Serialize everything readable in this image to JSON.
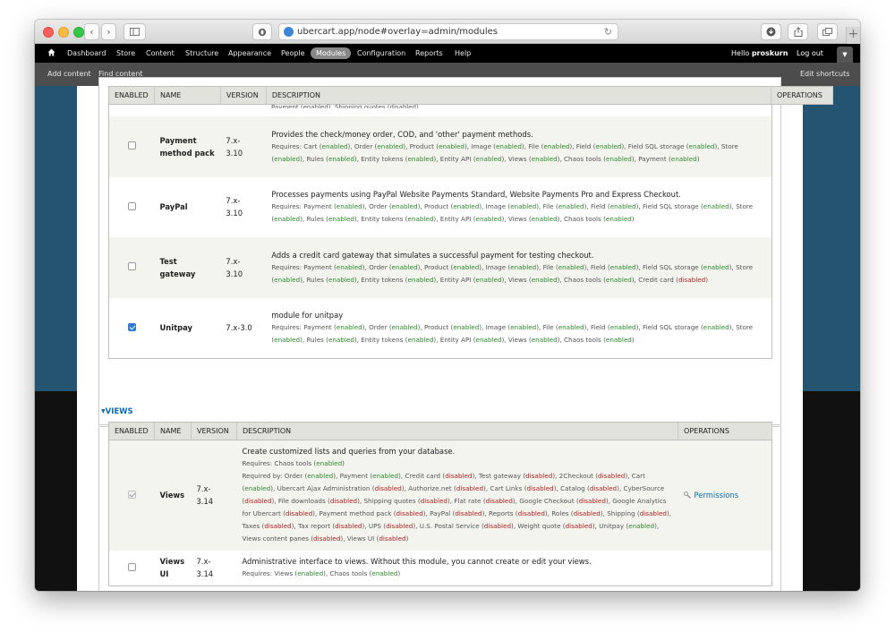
{
  "browser": {
    "url": "ubercart.app/node#overlay=admin/modules",
    "plus_label": "+"
  },
  "toolbar": {
    "menu": [
      {
        "label": "Dashboard"
      },
      {
        "label": "Store"
      },
      {
        "label": "Content"
      },
      {
        "label": "Structure"
      },
      {
        "label": "Appearance"
      },
      {
        "label": "People"
      },
      {
        "label": "Modules"
      },
      {
        "label": "Configuration"
      },
      {
        "label": "Reports"
      },
      {
        "label": "Help"
      }
    ],
    "hello_prefix": "Hello",
    "username": "proskurn",
    "logout": "Log out"
  },
  "shortcuts": {
    "add_content": "Add content",
    "find_content": "Find content",
    "edit_shortcuts": "Edit shortcuts"
  },
  "table1": {
    "headers": {
      "enabled": "ENABLED",
      "name": "NAME",
      "version": "VERSION",
      "description": "DESCRIPTION",
      "operations": "OPERATIONS"
    },
    "cutoff_text": "Payment (enabled), Shipping quotes (disabled)",
    "rows": [
      {
        "name1": "Payment",
        "name2": "method pack",
        "ver1": "7.x-",
        "ver2": "3.10",
        "checked": false,
        "desc": "Provides the check/money order, COD, and 'other' payment methods.",
        "req_label": "Requires:",
        "deps": [
          [
            "Cart",
            "enabled"
          ],
          [
            "Order",
            "enabled"
          ],
          [
            "Product",
            "enabled"
          ],
          [
            "Image",
            "enabled"
          ],
          [
            "File",
            "enabled"
          ],
          [
            "Field",
            "enabled"
          ],
          [
            "Field SQL storage",
            "enabled"
          ],
          [
            "Store",
            "enabled"
          ],
          [
            "Rules",
            "enabled"
          ],
          [
            "Entity tokens",
            "enabled"
          ],
          [
            "Entity API",
            "enabled"
          ],
          [
            "Views",
            "enabled"
          ],
          [
            "Chaos tools",
            "enabled"
          ],
          [
            "Payment",
            "enabled"
          ]
        ]
      },
      {
        "name1": "PayPal",
        "name2": "",
        "ver1": "7.x-",
        "ver2": "3.10",
        "checked": false,
        "desc": "Processes payments using PayPal Website Payments Standard, Website Payments Pro and Express Checkout.",
        "req_label": "Requires:",
        "deps": [
          [
            "Payment",
            "enabled"
          ],
          [
            "Order",
            "enabled"
          ],
          [
            "Product",
            "enabled"
          ],
          [
            "Image",
            "enabled"
          ],
          [
            "File",
            "enabled"
          ],
          [
            "Field",
            "enabled"
          ],
          [
            "Field SQL storage",
            "enabled"
          ],
          [
            "Store",
            "enabled"
          ],
          [
            "Rules",
            "enabled"
          ],
          [
            "Entity tokens",
            "enabled"
          ],
          [
            "Entity API",
            "enabled"
          ],
          [
            "Views",
            "enabled"
          ],
          [
            "Chaos tools",
            "enabled"
          ]
        ]
      },
      {
        "name1": "Test gateway",
        "name2": "",
        "ver1": "7.x-",
        "ver2": "3.10",
        "checked": false,
        "desc": "Adds a credit card gateway that simulates a successful payment for testing checkout.",
        "req_label": "Requires:",
        "deps": [
          [
            "Payment",
            "enabled"
          ],
          [
            "Order",
            "enabled"
          ],
          [
            "Product",
            "enabled"
          ],
          [
            "Image",
            "enabled"
          ],
          [
            "File",
            "enabled"
          ],
          [
            "Field",
            "enabled"
          ],
          [
            "Field SQL storage",
            "enabled"
          ],
          [
            "Store",
            "enabled"
          ],
          [
            "Rules",
            "enabled"
          ],
          [
            "Entity tokens",
            "enabled"
          ],
          [
            "Entity API",
            "enabled"
          ],
          [
            "Views",
            "enabled"
          ],
          [
            "Chaos tools",
            "enabled"
          ],
          [
            "Credit card",
            "disabled"
          ]
        ]
      },
      {
        "name1": "Unitpay",
        "name2": "",
        "ver1": "7.x-3.0",
        "ver2": "",
        "checked": true,
        "desc": "module for unitpay",
        "req_label": "Requires:",
        "deps": [
          [
            "Payment",
            "enabled"
          ],
          [
            "Order",
            "enabled"
          ],
          [
            "Product",
            "enabled"
          ],
          [
            "Image",
            "enabled"
          ],
          [
            "File",
            "enabled"
          ],
          [
            "Field",
            "enabled"
          ],
          [
            "Field SQL storage",
            "enabled"
          ],
          [
            "Store",
            "enabled"
          ],
          [
            "Rules",
            "enabled"
          ],
          [
            "Entity tokens",
            "enabled"
          ],
          [
            "Entity API",
            "enabled"
          ],
          [
            "Views",
            "enabled"
          ],
          [
            "Chaos tools",
            "enabled"
          ]
        ]
      }
    ]
  },
  "views_section": {
    "legend": "VIEWS",
    "headers": {
      "enabled": "ENABLED",
      "name": "NAME",
      "version": "VERSION",
      "description": "DESCRIPTION",
      "operations": "OPERATIONS"
    },
    "rows": [
      {
        "name1": "Views",
        "name2": "",
        "ver1": "7.x-",
        "ver2": "3.14",
        "checked": true,
        "locked": true,
        "desc": "Create customized lists and queries from your database.",
        "req_label": "Requires:",
        "deps": [
          [
            "Chaos tools",
            "enabled"
          ]
        ],
        "reqby_label": "Required by:",
        "reqby": [
          [
            "Order",
            "enabled"
          ],
          [
            "Payment",
            "enabled"
          ],
          [
            "Credit card",
            "disabled"
          ],
          [
            "Test gateway",
            "disabled"
          ],
          [
            "2Checkout",
            "disabled"
          ],
          [
            "Cart",
            "enabled"
          ],
          [
            "Ubercart Ajax Administration",
            "disabled"
          ],
          [
            "Authorize.net",
            "disabled"
          ],
          [
            "Cart Links",
            "disabled"
          ],
          [
            "Catalog",
            "disabled"
          ],
          [
            "CyberSource",
            "disabled"
          ],
          [
            "File downloads",
            "disabled"
          ],
          [
            "Shipping quotes",
            "disabled"
          ],
          [
            "Flat rate",
            "disabled"
          ],
          [
            "Google Checkout",
            "disabled"
          ],
          [
            "Google Analytics for Ubercart",
            "disabled"
          ],
          [
            "Payment method pack",
            "disabled"
          ],
          [
            "PayPal",
            "disabled"
          ],
          [
            "Reports",
            "disabled"
          ],
          [
            "Roles",
            "disabled"
          ],
          [
            "Shipping",
            "disabled"
          ],
          [
            "Taxes",
            "disabled"
          ],
          [
            "Tax report",
            "disabled"
          ],
          [
            "UPS",
            "disabled"
          ],
          [
            "U.S. Postal Service",
            "disabled"
          ],
          [
            "Weight quote",
            "disabled"
          ],
          [
            "Unitpay",
            "enabled"
          ],
          [
            "Views content panes",
            "disabled"
          ],
          [
            "Views UI",
            "disabled"
          ]
        ],
        "operation": "Permissions"
      },
      {
        "name1": "Views",
        "name2": "UI",
        "ver1": "7.x-",
        "ver2": "3.14",
        "checked": false,
        "locked": false,
        "desc": "Administrative interface to views. Without this module, you cannot create or edit your views.",
        "req_label": "Requires:",
        "deps": [
          [
            "Views",
            "enabled"
          ],
          [
            "Chaos tools",
            "enabled"
          ]
        ]
      }
    ]
  }
}
